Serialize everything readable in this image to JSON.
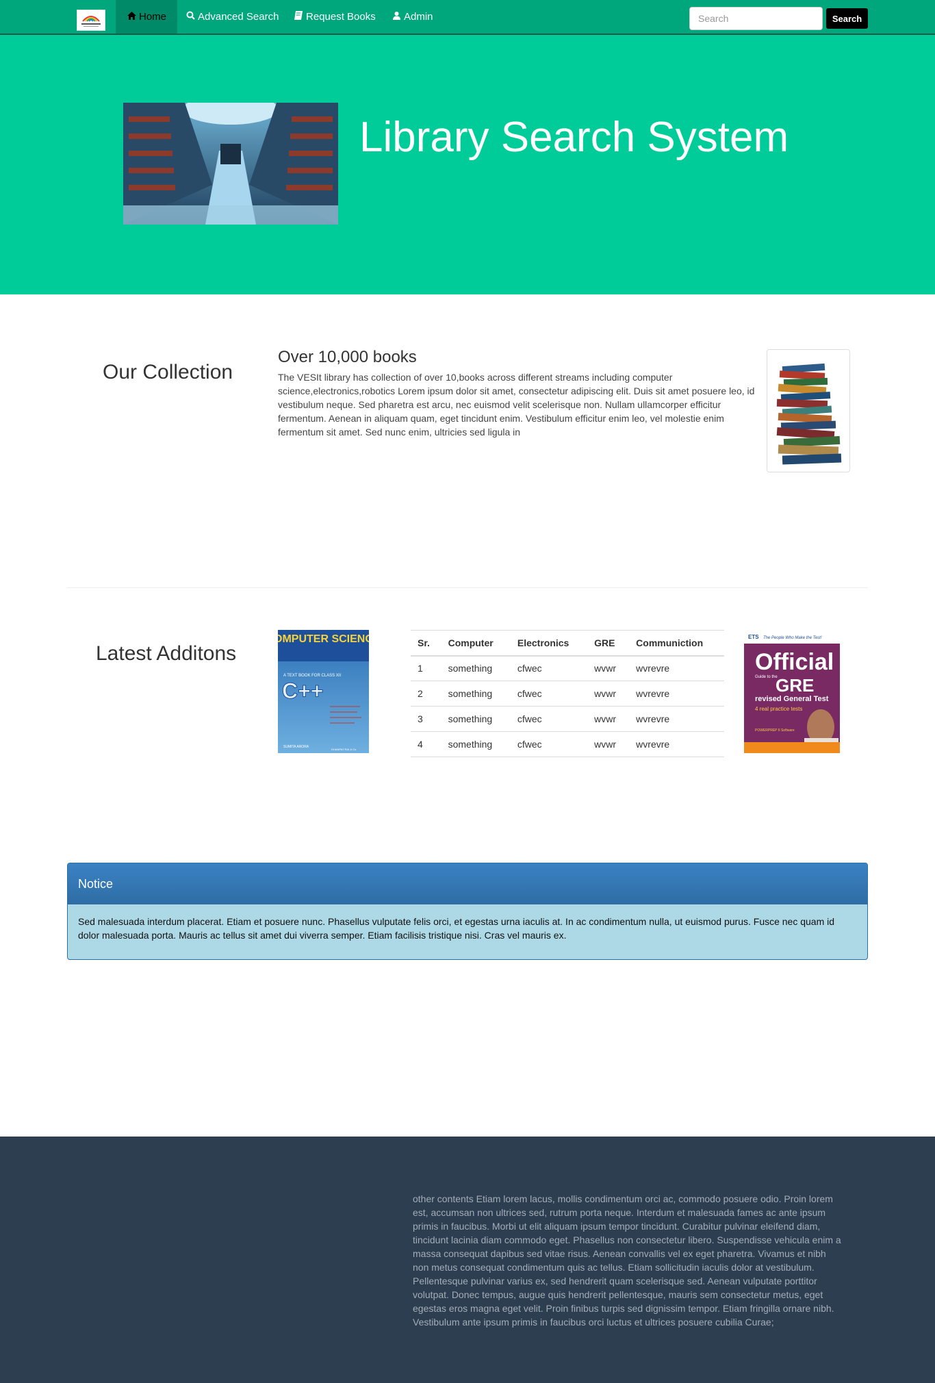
{
  "nav": {
    "items": [
      {
        "label": "Home",
        "icon": "home-icon"
      },
      {
        "label": "Advanced Search",
        "icon": "search-icon"
      },
      {
        "label": "Request Books",
        "icon": "book-icon"
      },
      {
        "label": "Admin",
        "icon": "user-icon"
      }
    ],
    "search_placeholder": "Search",
    "search_button": "Search"
  },
  "hero": {
    "title": "Library Search System"
  },
  "collection": {
    "heading": "Our Collection",
    "subtitle": "Over 10,000 books",
    "text": "The VESIt library has collection of over 10,books across different streams including computer science,electronics,robotics Lorem ipsum dolor sit amet, consectetur adipiscing elit. Duis sit amet posuere leo, id vestibulum neque. Sed pharetra est arcu, nec euismod velit scelerisque non. Nullam ullamcorper efficitur fermentum. Aenean in aliquam quam, eget tincidunt enim. Vestibulum efficitur enim leo, vel molestie enim fermentum sit amet. Sed nunc enim, ultricies sed ligula in"
  },
  "latest": {
    "heading": "Latest Additons",
    "cover1": {
      "title": "COMPUTER SCIENCE",
      "subtitle": "A TEXT BOOK FOR CLASS XII",
      "lang": "C++",
      "author": "SUMITA ARORA",
      "publisher": "DHANPAT RAI & Co."
    },
    "cover2": {
      "top": "The People Who Make the Test!",
      "brand": "ETS",
      "title": "Official",
      "guide": "Guide to the",
      "exam": "GRE",
      "sub": "revised General Test",
      "tests": "4 real practice tests",
      "software": "POWERPREP II Software"
    },
    "table": {
      "headers": [
        "Sr.",
        "Computer",
        "Electronics",
        "GRE",
        "Communiction"
      ],
      "rows": [
        [
          "1",
          "something",
          "cfwec",
          "wvwr",
          "wvrevre"
        ],
        [
          "2",
          "something",
          "cfwec",
          "wvwr",
          "wvrevre"
        ],
        [
          "3",
          "something",
          "cfwec",
          "wvwr",
          "wvrevre"
        ],
        [
          "4",
          "something",
          "cfwec",
          "wvwr",
          "wvrevre"
        ]
      ]
    }
  },
  "notice": {
    "title": "Notice",
    "body": "Sed malesuada interdum placerat. Etiam et posuere nunc. Phasellus vulputate felis orci, et egestas urna iaculis at. In ac condimentum nulla, ut euismod purus. Fusce nec quam id dolor malesuada porta. Mauris ac tellus sit amet dui viverra semper. Etiam facilisis tristique nisi. Cras vel mauris ex."
  },
  "footer": {
    "text": "other contents Etiam lorem lacus, mollis condimentum orci ac, commodo posuere odio. Proin lorem est, accumsan non ultrices sed, rutrum porta neque. Interdum et malesuada fames ac ante ipsum primis in faucibus. Morbi ut elit aliquam ipsum tempor tincidunt. Curabitur pulvinar eleifend diam, tincidunt lacinia diam commodo eget. Phasellus non consectetur libero. Suspendisse vehicula enim a massa consequat dapibus sed vitae risus. Aenean convallis vel ex eget pharetra. Vivamus et nibh non metus consequat condimentum quis ac tellus. Etiam sollicitudin iaculis dolor at vestibulum. Pellentesque pulvinar varius ex, sed hendrerit quam scelerisque sed. Aenean vulputate porttitor volutpat. Donec tempus, augue quis hendrerit pellentesque, mauris sem consectetur metus, eget egestas eros magna eget velit. Proin finibus turpis sed dignissim tempor. Etiam fringilla ornare nibh. Vestibulum ante ipsum primis in faucibus orci luctus et ultrices posuere cubilia Curae;"
  },
  "colors": {
    "navbar": "#00a67c",
    "hero": "#00cc99",
    "notice_header": "#2e6da4",
    "notice_body": "#add8e6",
    "footer": "#2c3e50"
  }
}
